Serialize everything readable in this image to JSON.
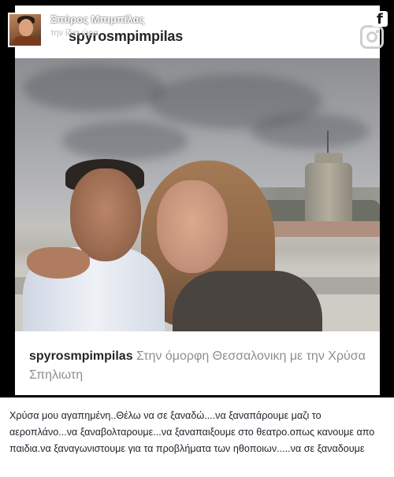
{
  "author": {
    "name": "Σπύρος Μπιμπίλας",
    "subtitle": "την ίδια ώρα"
  },
  "icons": {
    "facebook": "facebook-icon",
    "instagram": "instagram-icon"
  },
  "instagram_post": {
    "username_header": "spyrosmpimpilas",
    "caption_username": "spyrosmpimpilas",
    "caption_text": " Στην όμορφη Θεσσαλονικη με την Χρύσα Σπηλιωτη"
  },
  "fb_post_text": "Χρύσα μου αγαπημένη..Θέλω να σε ξαναδώ....να ξαναπάρουμε μαζι το αεροπλάνο...να ξαναβολταρουμε...να ξαναπαιξουμε στο θεατρο.οπως κανουμε απο παιδια.να ξαναγωνιστουμε για τα προβλήματα των ηθοποιων.....να σε ξαναδουμε",
  "colors": {
    "frame": "#000000",
    "caption_gray": "#8e8e8e",
    "username_dark": "#262626"
  }
}
